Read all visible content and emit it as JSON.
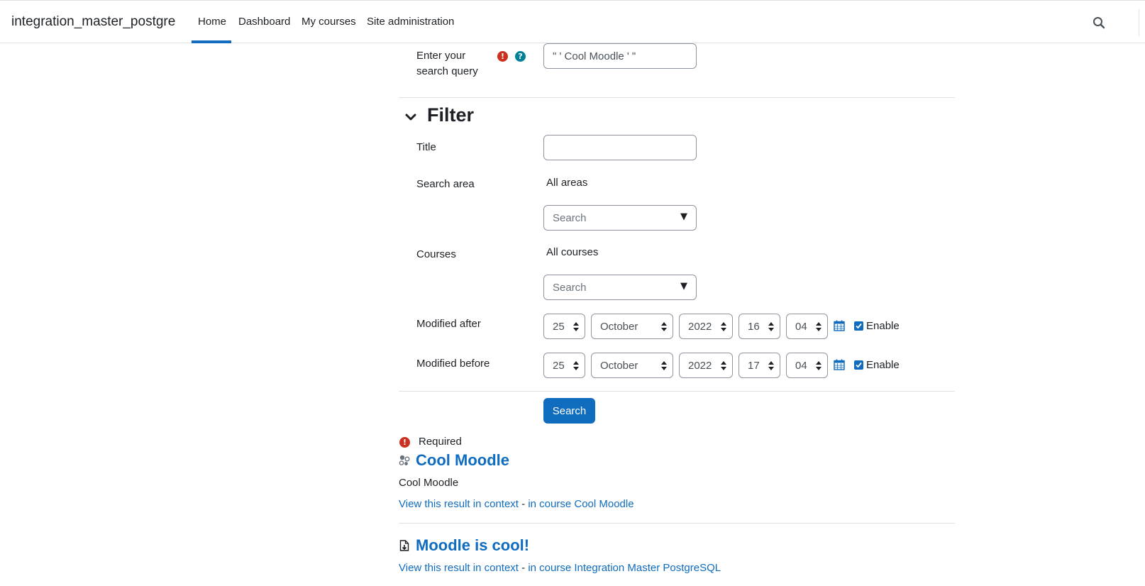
{
  "navbar": {
    "site_name": "integration_master_postgre",
    "items": [
      "Home",
      "Dashboard",
      "My courses",
      "Site administration"
    ],
    "search_icon": "search-icon"
  },
  "form": {
    "query": {
      "label_line1": "Enter your",
      "label_line2": "search query",
      "value": "\" ' Cool Moodle ' \"",
      "required_icon": "exclamation-icon",
      "help_icon": "question-icon"
    },
    "filter": {
      "heading": "Filter",
      "title_label": "Title",
      "title_value": "",
      "search_area_label": "Search area",
      "search_area_selected": "All areas",
      "search_area_placeholder": "Search",
      "courses_label": "Courses",
      "courses_selected": "All courses",
      "courses_placeholder": "Search",
      "dropdown_arrow": "▼",
      "modified_after": {
        "label": "Modified after",
        "day": "25",
        "month": "October",
        "year": "2022",
        "hour": "16",
        "minute": "04",
        "enable_label": "Enable",
        "enabled": true
      },
      "modified_before": {
        "label": "Modified before",
        "day": "25",
        "month": "October",
        "year": "2022",
        "hour": "17",
        "minute": "04",
        "enable_label": "Enable",
        "enabled": true
      }
    },
    "submit_label": "Search",
    "required_note": "Required"
  },
  "results": [
    {
      "title": "Cool Moodle",
      "icon": "course-icon",
      "description": "Cool Moodle",
      "context_link": "View this result in context",
      "separator": " - ",
      "course_link": "in course Cool Moodle"
    },
    {
      "title": "Moodle is cool!",
      "icon": "page-icon",
      "context_link": "View this result in context",
      "separator": " - ",
      "course_link": "in course Integration Master PostgreSQL"
    }
  ],
  "colors": {
    "accent": "#0f6cbf",
    "required": "#ca3120",
    "help": "#008196"
  }
}
